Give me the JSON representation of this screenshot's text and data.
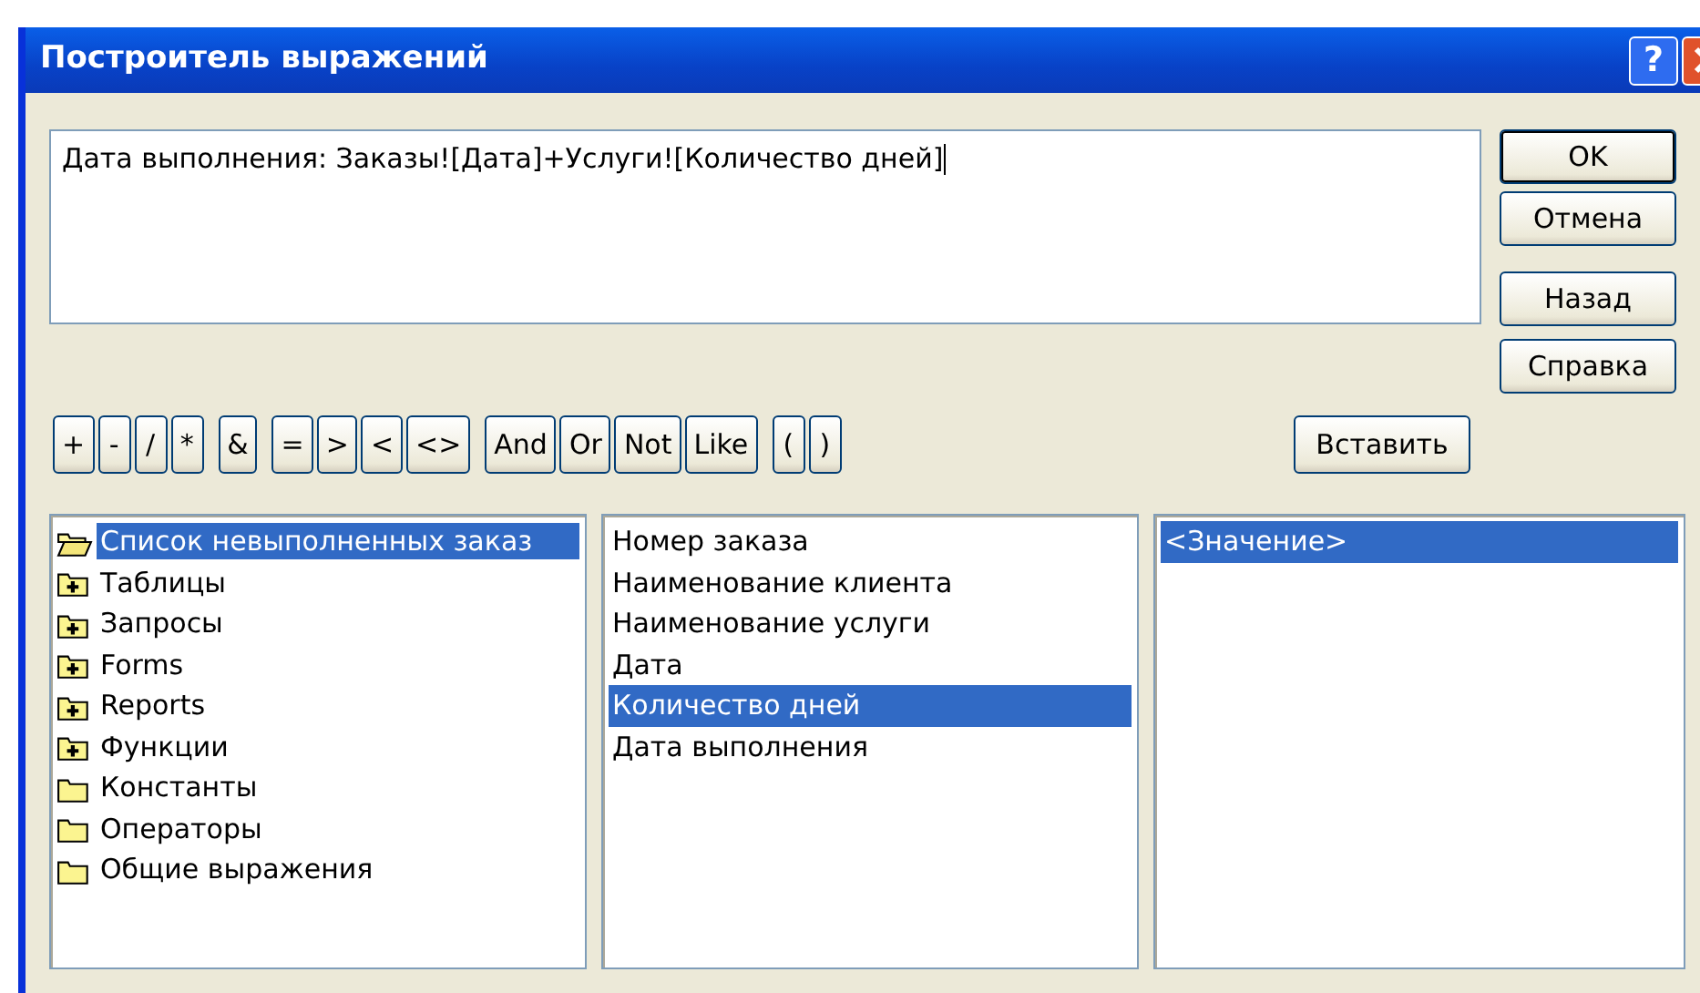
{
  "window": {
    "title": "Построитель выражений",
    "help_button": "?"
  },
  "expression": {
    "value": "Дата выполнения: Заказы![Дата]+Услуги![Количество дней]"
  },
  "side_buttons": [
    "OK",
    "Отмена",
    "Назад"
  ],
  "operators": [
    [
      "+",
      "-",
      "/",
      "*"
    ],
    [
      "&"
    ],
    [
      "=",
      ">",
      "<",
      "<>"
    ],
    [
      "And",
      "Or",
      "Not",
      "Like"
    ],
    [
      "(",
      ")"
    ]
  ],
  "insert_button": "Вставить",
  "help_side_button": "Справка",
  "tree": [
    {
      "label": "Список невыполненных заказ",
      "kind": "open",
      "selected": true
    },
    {
      "label": "Таблицы",
      "kind": "expandable",
      "selected": false
    },
    {
      "label": "Запросы",
      "kind": "expandable",
      "selected": false
    },
    {
      "label": "Forms",
      "kind": "expandable",
      "selected": false
    },
    {
      "label": "Reports",
      "kind": "expandable",
      "selected": false
    },
    {
      "label": "Функции",
      "kind": "expandable",
      "selected": false
    },
    {
      "label": "Константы",
      "kind": "plain",
      "selected": false
    },
    {
      "label": "Операторы",
      "kind": "plain",
      "selected": false
    },
    {
      "label": "Общие выражения",
      "kind": "plain",
      "selected": false
    }
  ],
  "fields": [
    {
      "label": "Номер заказа",
      "selected": false
    },
    {
      "label": "Наименование клиента",
      "selected": false
    },
    {
      "label": "Наименование услуги",
      "selected": false
    },
    {
      "label": "Дата",
      "selected": false
    },
    {
      "label": "Количество дней",
      "selected": true
    },
    {
      "label": "Дата выполнения",
      "selected": false
    }
  ],
  "values": [
    {
      "label": "<Значение>",
      "selected": true
    }
  ]
}
